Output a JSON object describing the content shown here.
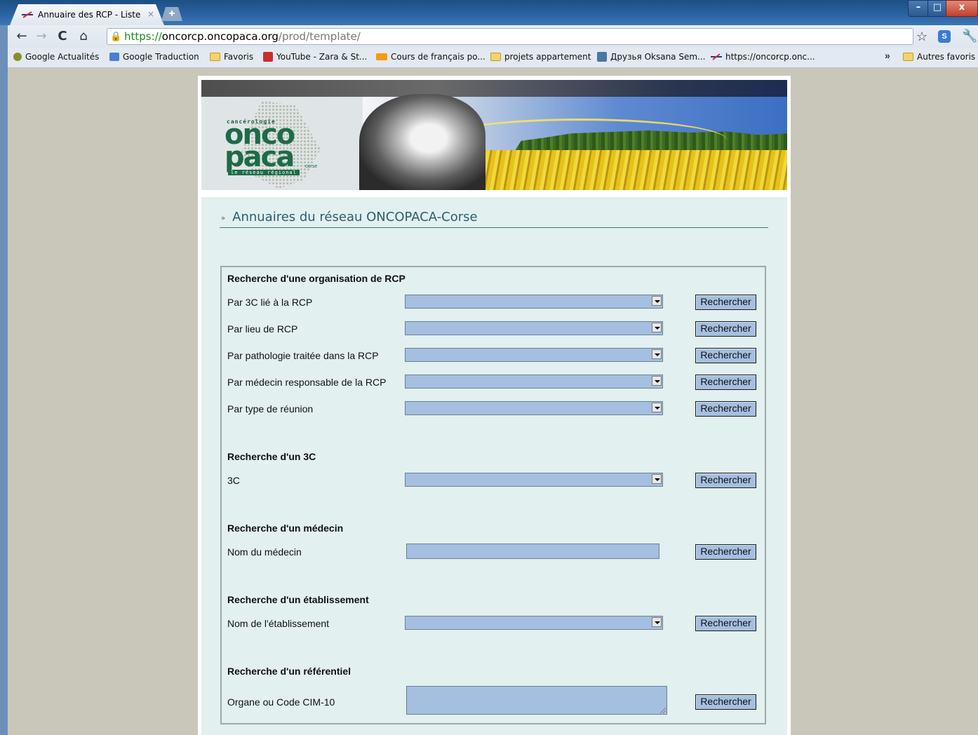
{
  "browser": {
    "tab_title": "Annuaire des RCP - Liste de",
    "tab_close": "×",
    "new_tab": "+",
    "window_min": "–",
    "window_max": "□",
    "window_close": "x",
    "nav": {
      "back": "←",
      "forward": "→",
      "reload": "C",
      "home": "⌂"
    },
    "url": {
      "scheme": "https://",
      "host": "oncorcp.oncopaca.org",
      "path": "/prod/template/"
    },
    "bookmarks": [
      {
        "label": "Google Actualités",
        "icon": "google-news-icon"
      },
      {
        "label": "Google Traduction",
        "icon": "google-translate-icon"
      },
      {
        "label": "Favoris",
        "icon": "folder-icon"
      },
      {
        "label": "YouTube - Zara & St...",
        "icon": "youtube-icon"
      },
      {
        "label": "Cours de français po...",
        "icon": "oix-icon"
      },
      {
        "label": "projets appartement",
        "icon": "folder-icon"
      },
      {
        "label": "Друзья Oksana Sem...",
        "icon": "vk-icon"
      },
      {
        "label": "https://oncorcp.onc...",
        "icon": "oncopaca-icon"
      }
    ],
    "bookmarks_more": "»",
    "other_bookmarks": "Autres favoris"
  },
  "logo": {
    "small": "cancérologie",
    "line1": "onco",
    "line2": "paca",
    "corse": "corse",
    "reseau": "le réseau régional"
  },
  "page": {
    "heading_bullet": "»",
    "heading": "Annuaires du réseau ONCOPACA-Corse"
  },
  "search": {
    "button_label": "Rechercher",
    "rcp": {
      "title": "Recherche d'une organisation de RCP",
      "rows": [
        "Par 3C lié à la RCP",
        "Par lieu de RCP",
        "Par pathologie traitée dans la RCP",
        "Par médecin responsable de la RCP",
        "Par type de réunion"
      ]
    },
    "c3": {
      "title": "Recherche d'un 3C",
      "label": "3C"
    },
    "medecin": {
      "title": "Recherche d'un médecin",
      "label": "Nom du médecin"
    },
    "etablissement": {
      "title": "Recherche d'un établissement",
      "label": "Nom de l'établissement"
    },
    "referentiel": {
      "title": "Recherche d'un référentiel",
      "label": "Organe ou Code CIM-10"
    }
  },
  "colors": {
    "input_fill": "#a5bfe0",
    "content_bg": "#e2f0ef",
    "heading": "#2b5e6e",
    "outer_bg": "#c8c7ba"
  }
}
